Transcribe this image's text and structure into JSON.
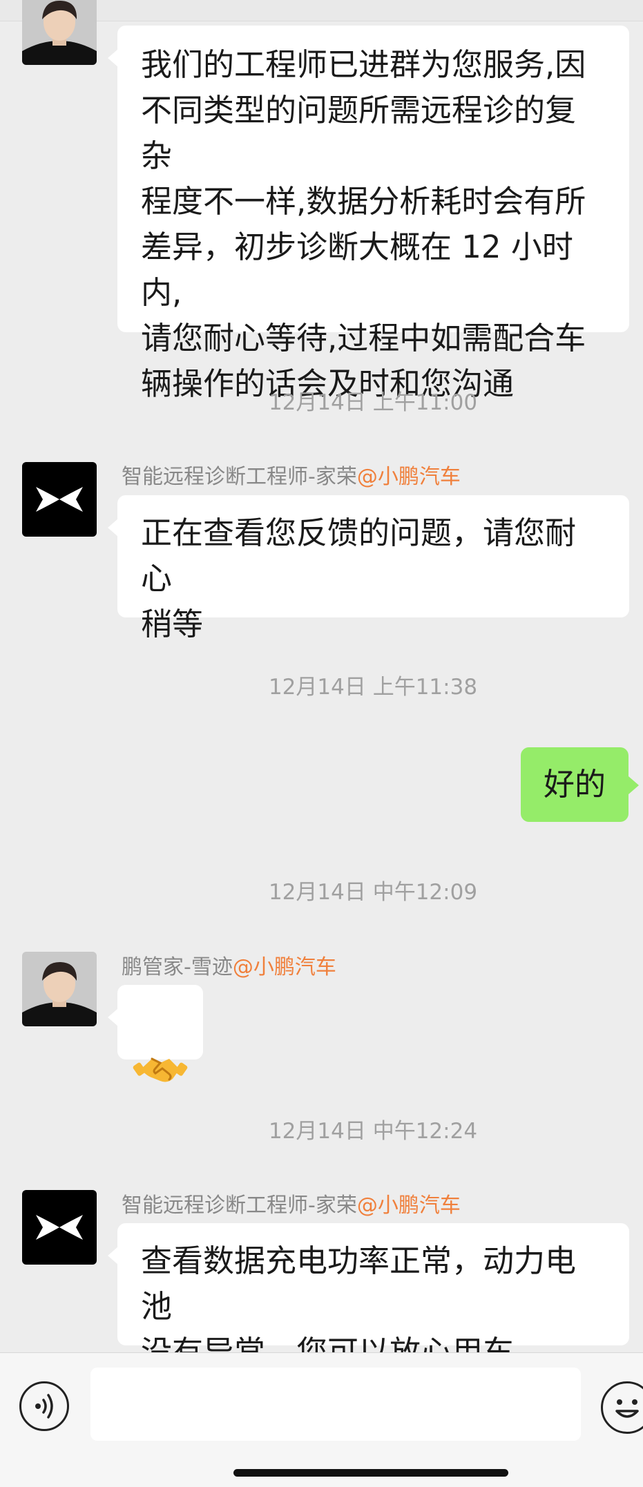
{
  "messages": {
    "m1": {
      "text": "我们的工程师已进群为您服务,因\n不同类型的问题所需远程诊的复杂\n程度不一样,数据分析耗时会有所\n差异，初步诊断大概在 12 小时内,\n请您耐心等待,过程中如需配合车\n辆操作的话会及时和您沟通"
    },
    "ts1": "12月14日 上午11:00",
    "m2": {
      "sender": "智能远程诊断工程师-家荣",
      "org": "@小鹏汽车",
      "text": "正在查看您反馈的问题，请您耐心\n稍等"
    },
    "ts2": "12月14日 上午11:38",
    "m3": {
      "text": "好的"
    },
    "ts3": "12月14日 中午12:09",
    "m4": {
      "sender": "鹏管家-雪迹",
      "org": "@小鹏汽车",
      "emoji": "🤝"
    },
    "ts4": "12月14日 中午12:24",
    "m5": {
      "sender": "智能远程诊断工程师-家荣",
      "org": "@小鹏汽车",
      "text": "查看数据充电功率正常，动力电池\n没有异常，您可以放心用车"
    }
  },
  "input": {
    "value": "",
    "voice_icon": "voice-icon",
    "emoji_icon": "emoji-icon"
  },
  "colors": {
    "brand_orange": "#f0803c",
    "self_bubble": "#95ec69",
    "background": "#ededed"
  }
}
